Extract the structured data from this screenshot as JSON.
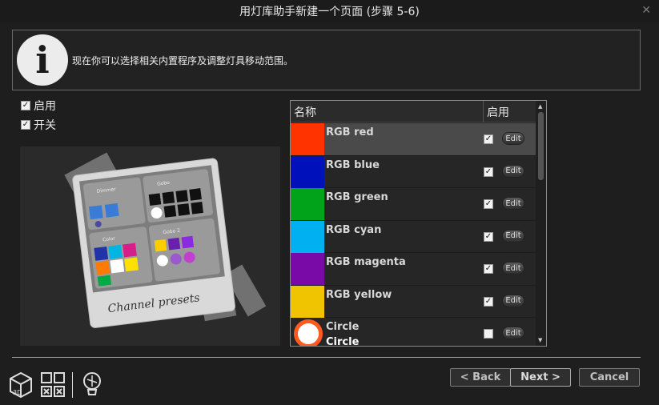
{
  "window": {
    "title": "用灯库助手新建一个页面 (步骤 5-6)"
  },
  "info": {
    "text": "现在你可以选择相关内置程序及调整灯具移动范围。"
  },
  "options": {
    "enable_label": "启用",
    "switch_label": "开关"
  },
  "preview": {
    "caption": "Channel presets",
    "dimmer_label": "Dimmer",
    "gobo_label": "Gobo",
    "gobo2_label": "Gobo 2",
    "color_label": "Color"
  },
  "list": {
    "header_name": "名称",
    "header_enable": "启用",
    "edit_label": "Edit",
    "rows": [
      {
        "name": "RGB red",
        "color": "#ff3300",
        "checked": true,
        "selected": true
      },
      {
        "name": "RGB blue",
        "color": "#0011bb",
        "checked": true
      },
      {
        "name": "RGB green",
        "color": "#00a31a",
        "checked": true
      },
      {
        "name": "RGB cyan",
        "color": "#00b0f0",
        "checked": true
      },
      {
        "name": "RGB magenta",
        "color": "#7a0aa8",
        "checked": true
      },
      {
        "name": "RGB yellow",
        "color": "#f0c400",
        "checked": true
      },
      {
        "name": "Circle",
        "subname": "Circle",
        "checked": false
      }
    ]
  },
  "buttons": {
    "back": "< Back",
    "next": "Next >",
    "cancel": "Cancel"
  },
  "bottom_icons": [
    "3d-icon",
    "grid-icon",
    "bulb-icon"
  ]
}
